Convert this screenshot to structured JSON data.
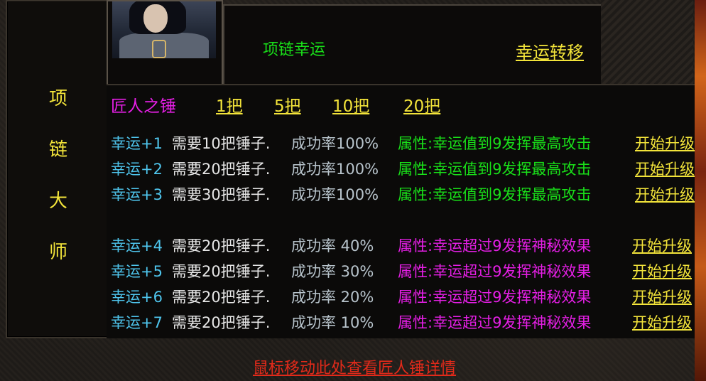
{
  "side_title": [
    "项",
    "链",
    "大",
    "师"
  ],
  "header": {
    "title": "项链幸运",
    "transfer_link": "幸运转移"
  },
  "hammer_bar": {
    "label": "匠人之锤",
    "options": [
      "1把",
      "5把",
      "10把",
      "20把"
    ]
  },
  "upgrade_rows": [
    {
      "level": "幸运+1",
      "need": "需要10把锤子.",
      "rate": "成功率100%",
      "attr": "属性:幸运值到9发挥最高攻击",
      "action": "开始升级"
    },
    {
      "level": "幸运+2",
      "need": "需要20把锤子.",
      "rate": "成功率100%",
      "attr": "属性:幸运值到9发挥最高攻击",
      "action": "开始升级"
    },
    {
      "level": "幸运+3",
      "need": "需要30把锤子.",
      "rate": "成功率100%",
      "attr": "属性:幸运值到9发挥最高攻击",
      "action": "开始升级"
    },
    {
      "level": "幸运+4",
      "need": "需要20把锤子.",
      "rate": "成功率 40%",
      "attr": "属性:幸运超过9发挥神秘效果",
      "action": "开始升级"
    },
    {
      "level": "幸运+5",
      "need": "需要20把锤子.",
      "rate": "成功率 30%",
      "attr": "属性:幸运超过9发挥神秘效果",
      "action": "开始升级"
    },
    {
      "level": "幸运+6",
      "need": "需要20把锤子.",
      "rate": "成功率 20%",
      "attr": "属性:幸运超过9发挥神秘效果",
      "action": "开始升级"
    },
    {
      "level": "幸运+7",
      "need": "需要20把锤子.",
      "rate": "成功率 10%",
      "attr": "属性:幸运超过9发挥神秘效果",
      "action": "开始升级"
    }
  ],
  "footer": {
    "hover_hint": "鼠标移动此处查看匠人锤详情"
  },
  "colors": {
    "yellow": "#f3e43a",
    "green": "#19e019",
    "magenta": "#e61fe6",
    "cyan": "#4fc6ee",
    "red": "#e22a1a"
  }
}
